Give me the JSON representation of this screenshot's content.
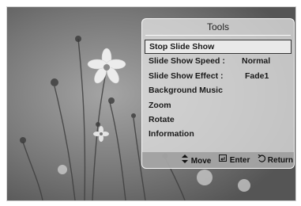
{
  "tools": {
    "title": "Tools",
    "items": [
      {
        "label": "Stop Slide Show",
        "value": ""
      },
      {
        "label": "Slide Show Speed :",
        "value": "Normal"
      },
      {
        "label": "Slide Show Effect :",
        "value": "Fade1"
      },
      {
        "label": "Background Music",
        "value": ""
      },
      {
        "label": "Zoom",
        "value": ""
      },
      {
        "label": "Rotate",
        "value": ""
      },
      {
        "label": "Information",
        "value": ""
      }
    ],
    "footer": {
      "move": {
        "icon": "updown-arrow-icon",
        "label": "Move"
      },
      "enter": {
        "icon": "enter-icon",
        "label": "Enter"
      },
      "return": {
        "icon": "return-icon",
        "label": "Return"
      }
    }
  }
}
